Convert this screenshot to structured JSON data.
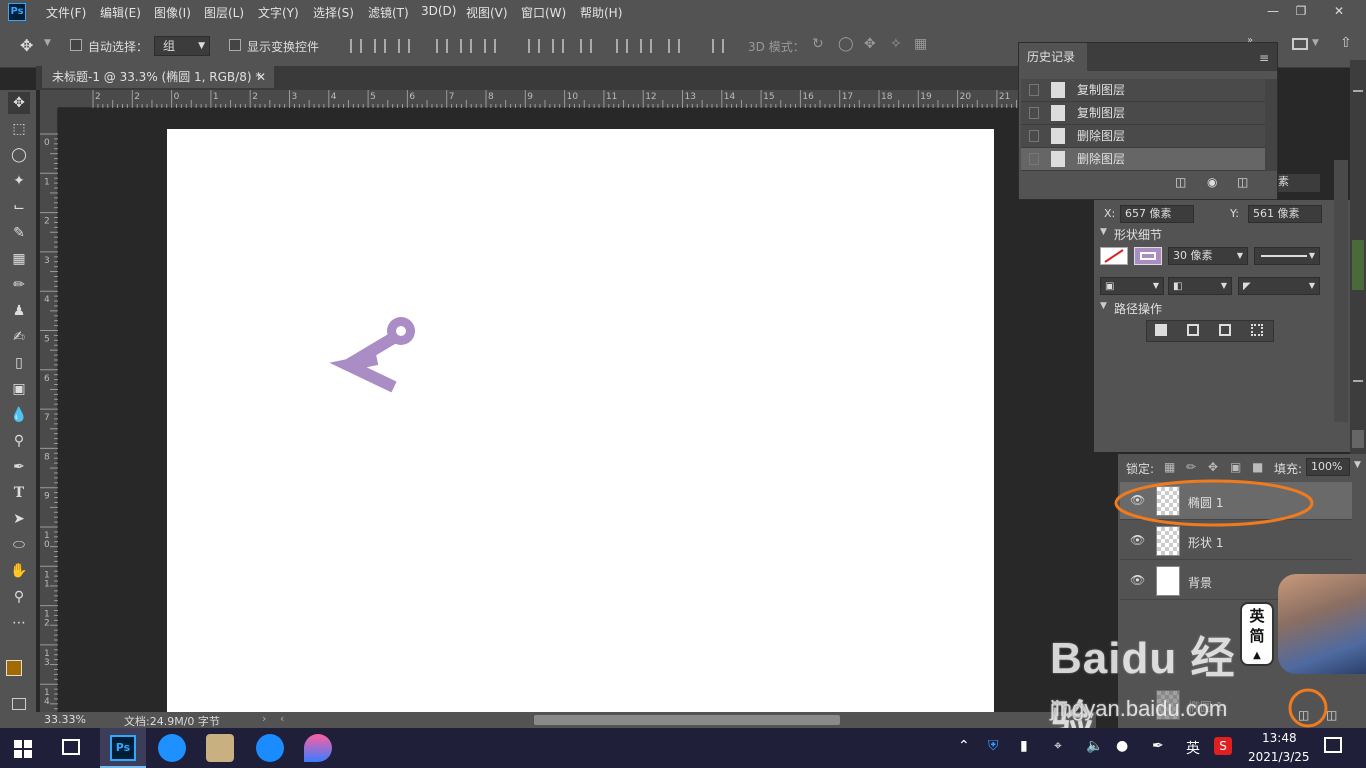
{
  "app": {
    "logo_text": "Ps"
  },
  "menu": [
    "文件(F)",
    "编辑(E)",
    "图像(I)",
    "图层(L)",
    "文字(Y)",
    "选择(S)",
    "滤镜(T)",
    "3D(D)",
    "视图(V)",
    "窗口(W)",
    "帮助(H)"
  ],
  "options": {
    "auto_select_label": "自动选择：",
    "auto_select_value": "组",
    "show_transform_label": "显示变换控件",
    "mode3d_label": "3D 模式："
  },
  "document": {
    "tab_title": "未标题-1 @ 33.3% (椭圆 1, RGB/8) *"
  },
  "ruler": {
    "h_ticks": [
      "2",
      "2",
      "0",
      "1",
      "2",
      "3",
      "4",
      "5",
      "6",
      "7",
      "8",
      "9",
      "10",
      "11",
      "12",
      "13",
      "14",
      "15",
      "16",
      "17",
      "18",
      "19",
      "20",
      "21"
    ],
    "v_ticks": [
      "0",
      "1",
      "2",
      "3",
      "4",
      "5",
      "6",
      "7",
      "8",
      "9",
      "1 0",
      "1 1",
      "1 2",
      "1 3",
      "1 4"
    ]
  },
  "status": {
    "zoom": "33.33%",
    "doc_info": "文档:24.9M/0 字节"
  },
  "history": {
    "title": "历史记录",
    "items": [
      "复制图层",
      "复制图层",
      "删除图层",
      "删除图层"
    ]
  },
  "properties": {
    "partial_value": "素",
    "x_label": "X:",
    "x_value": "657 像素",
    "y_label": "Y:",
    "y_value": "561 像素",
    "shape_details_label": "形状细节",
    "stroke_width": "30 像素",
    "path_ops_label": "路径操作"
  },
  "layers": {
    "lock_label": "锁定:",
    "fill_label": "填充:",
    "fill_value": "100%",
    "items": [
      {
        "name": "椭圆 1"
      },
      {
        "name": "形状 1"
      },
      {
        "name": "背景"
      }
    ],
    "ghost_item": "椭圆 1"
  },
  "ime": {
    "line1": "英",
    "line2": "简"
  },
  "watermark": {
    "brand": "Baidu 经验",
    "url": "jingyan.baidu.com"
  },
  "taskbar": {
    "time": "13:48",
    "date": "2021/3/25",
    "lang": "英"
  },
  "colors": {
    "shape": "#a98dc4",
    "highlight": "#f07a1e",
    "foreground": "#a36a00"
  }
}
